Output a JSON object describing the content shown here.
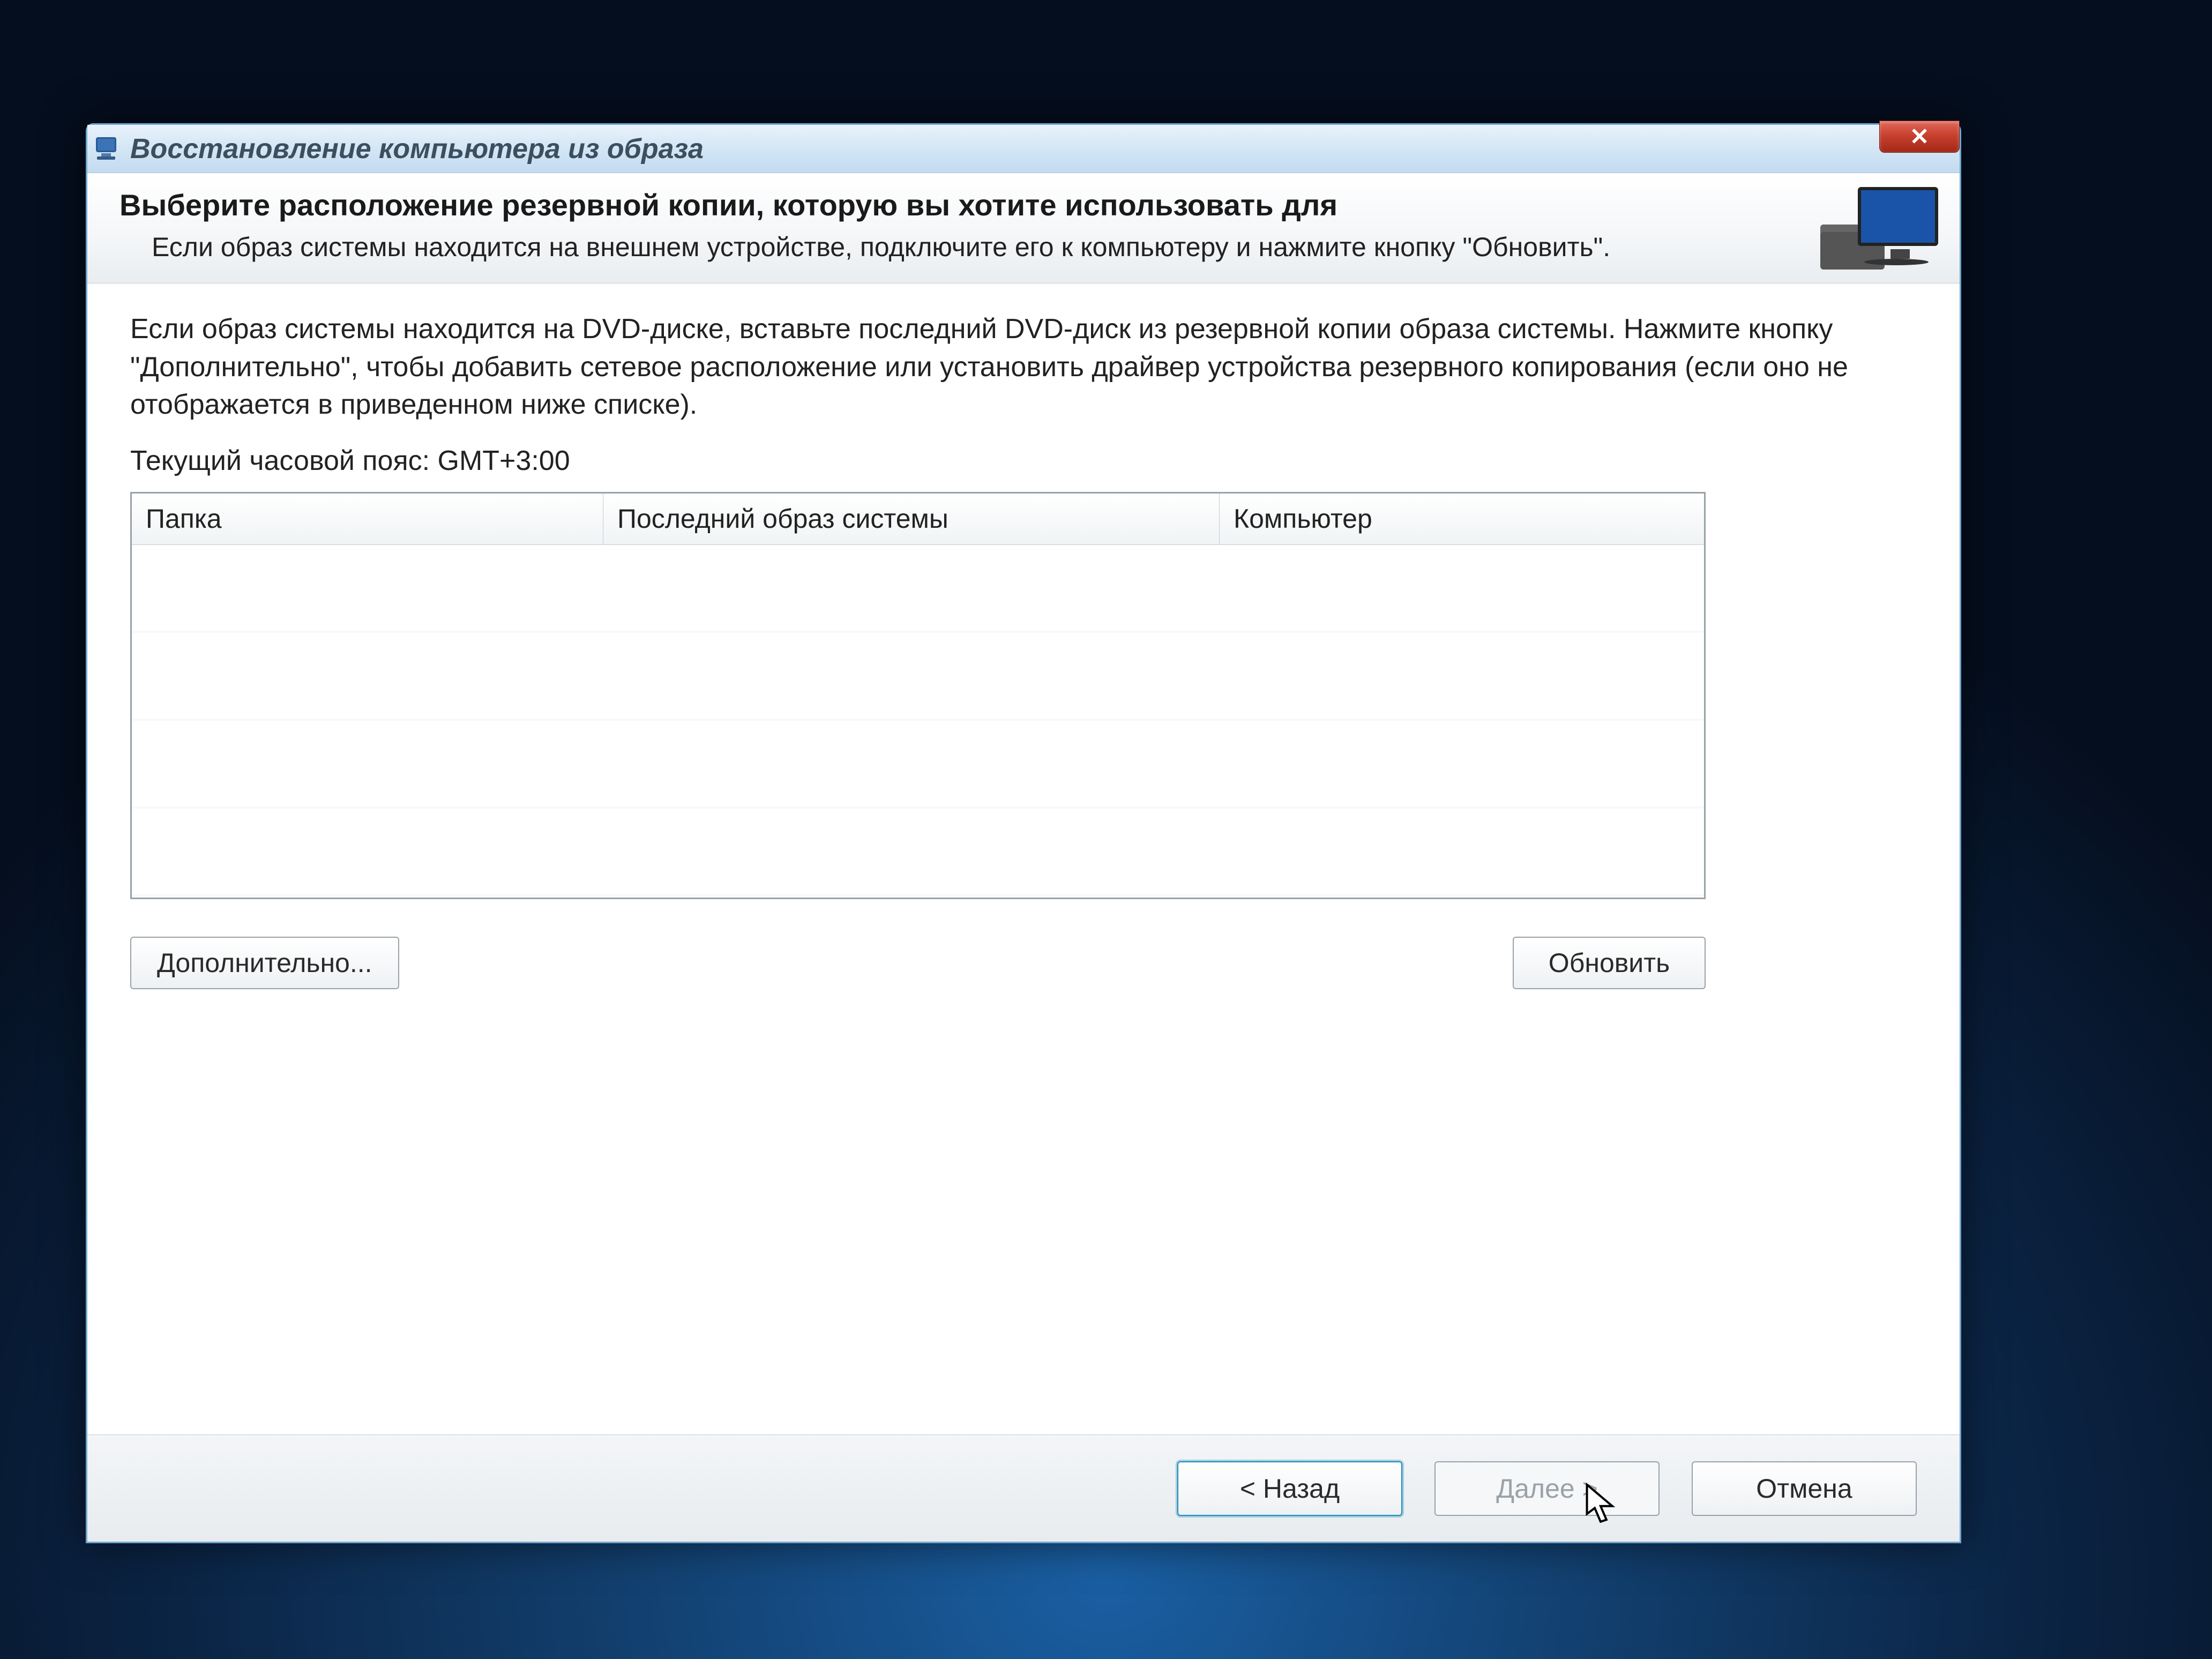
{
  "window": {
    "title": "Восстановление компьютера из образа"
  },
  "header": {
    "heading": "Выберите расположение резервной копии, которую вы хотите использовать для",
    "subtext": "Если образ системы находится на внешнем устройстве, подключите его к компьютеру и нажмите кнопку \"Обновить\"."
  },
  "body": {
    "instructions": "Если образ системы находится на DVD-диске, вставьте последний DVD-диск из резервной копии образа системы. Нажмите кнопку \"Дополнительно\", чтобы добавить сетевое расположение или установить драйвер устройства резервного копирования (если оно не отображается в приведенном ниже списке).",
    "timezone_label": "Текущий часовой пояс: GMT+3:00"
  },
  "list": {
    "columns": [
      "Папка",
      "Последний образ системы",
      "Компьютер"
    ],
    "rows": []
  },
  "buttons": {
    "advanced": "Дополнительно...",
    "refresh": "Обновить",
    "back": "< Назад",
    "next": "Далее >",
    "cancel": "Отмена"
  }
}
